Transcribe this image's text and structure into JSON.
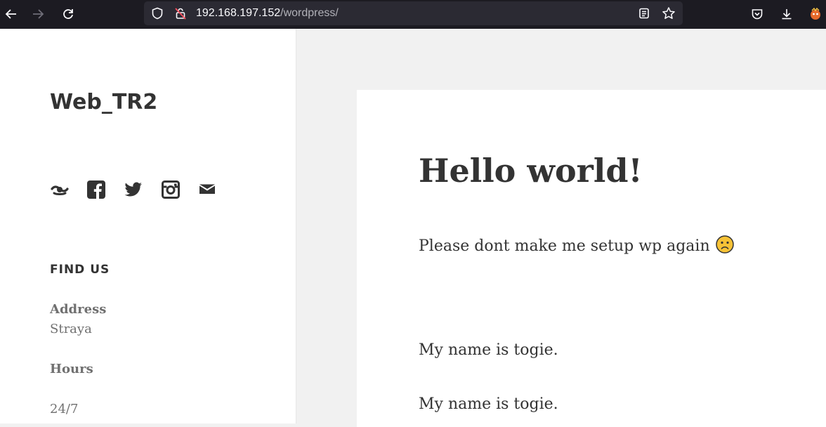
{
  "browser": {
    "url_host": "192.168.197.152",
    "url_path": "/wordpress/"
  },
  "sidebar": {
    "site_title": "Web_TR2",
    "social_icons": [
      "wordpress-icon",
      "facebook-icon",
      "twitter-icon",
      "instagram-icon",
      "mail-icon"
    ],
    "widget": {
      "title": "FIND US",
      "address_label": "Address",
      "address_value": "Straya",
      "hours_label": "Hours",
      "hours_value": "24/7"
    }
  },
  "post": {
    "title": "Hello world!",
    "paragraph1": "Please dont make me setup wp again",
    "paragraph2": "My name is togie.",
    "paragraph3": "My name is togie."
  }
}
